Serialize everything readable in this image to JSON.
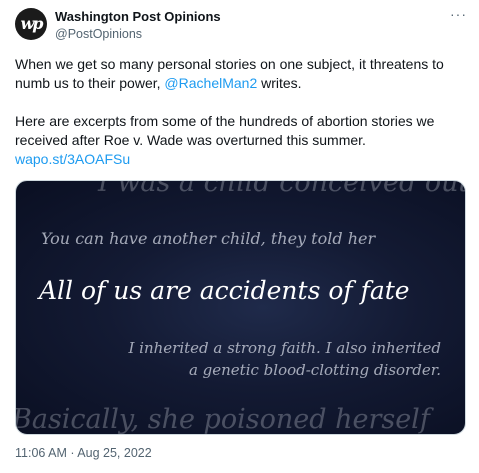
{
  "author": {
    "name": "Washington Post Opinions",
    "handle": "@PostOpinions",
    "avatar_text": "wp"
  },
  "more_label": "···",
  "tweet": {
    "p1_before": "When we get so many personal stories on one subject, it threatens to numb us to their power, ",
    "p1_mention": "@RachelMan2",
    "p1_after": " writes.",
    "p2": "Here are excerpts from some of the hundreds of abortion stories we received after Roe v. Wade was overturned this summer.",
    "link": "wapo.st/3AOAFSu"
  },
  "media": {
    "line1": "I was a child conceived out of",
    "line2": "You can have another child, they told her",
    "line3": "All of us are accidents of fate",
    "line4": "I inherited a strong faith. I also inherited",
    "line5": "a genetic blood-clotting disorder.",
    "line6": "Basically, she poisoned herself"
  },
  "timestamp": "11:06 AM · Aug 25, 2022"
}
